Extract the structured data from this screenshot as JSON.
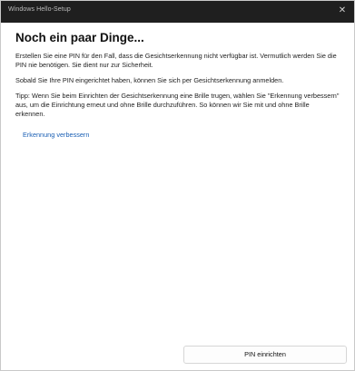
{
  "window": {
    "title": "Windows Hello-Setup",
    "close_glyph": "✕"
  },
  "main": {
    "heading": "Noch ein paar Dinge...",
    "paragraph1": "Erstellen Sie eine PIN für den Fall, dass die Gesichtserkennung nicht verfügbar ist. Vermutlich werden Sie die PIN nie benötigen. Sie dient nur zur Sicherheit.",
    "paragraph2": "Sobald Sie Ihre PIN eingerichtet haben, können Sie sich per Gesichtserkennung anmelden.",
    "paragraph3": "Tipp: Wenn Sie beim Einrichten der Gesichtserkennung eine Brille trugen, wählen Sie \"Erkennung verbessern\" aus, um die Einrichtung erneut und ohne Brille durchzuführen. So können wir Sie mit und ohne Brille erkennen.",
    "link_label": "Erkennung verbessern"
  },
  "footer": {
    "button_label": "PIN einrichten"
  },
  "colors": {
    "titlebar": "#1f1f1f",
    "link": "#1a5fb4",
    "background": "#ffffff"
  }
}
